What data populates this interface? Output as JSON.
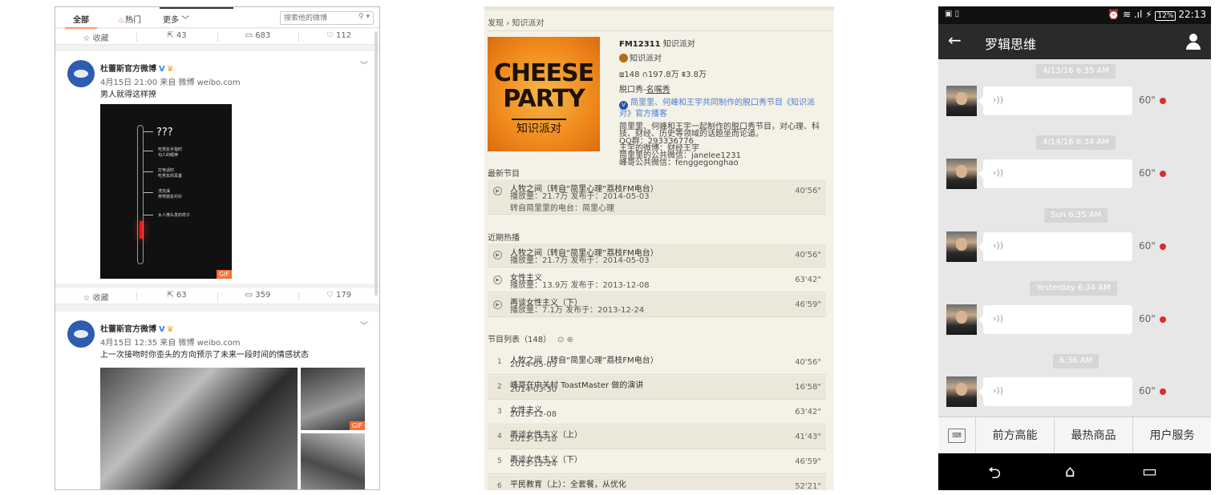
{
  "weibo": {
    "tabs": {
      "all": "全部",
      "hot_icon": "♨",
      "hot": "热门",
      "more": "更多 ﹀"
    },
    "search_placeholder": "搜索他的微博",
    "top_actions": {
      "favorite": "☆ 收藏",
      "repost": "⇱ 43",
      "comment": "▭ 683",
      "like": "♡ 112"
    },
    "posts": [
      {
        "author": "杜蕾斯官方微博",
        "time": "4月15日 21:00 来自 微博 weibo.com",
        "text": "男人就得这样撩",
        "gif_question": "???",
        "gif_labels": [
          "吃男友手指时\n勾人的眼神",
          "打电话时\n吃男友的耳垂",
          "洗完澡\n穿男朋友衬衫",
          "女人撩头发的样子"
        ],
        "gif_badge": "GIF",
        "actions": {
          "favorite": "☆ 收藏",
          "repost": "⇱ 63",
          "comment": "▭ 359",
          "like": "♡ 179"
        }
      },
      {
        "author": "杜蕾斯官方微博",
        "time": "4月15日 12:35 来自 微博 weibo.com",
        "text": "上一次接吻时你歪头的方向预示了未来一段时间的情感状态",
        "gif_badge": "GIF"
      }
    ]
  },
  "podcast": {
    "breadcrumb": "发现 › 知识派对",
    "cover": {
      "line1": "CHEESE",
      "line2": "PARTY",
      "line3": "知识派对"
    },
    "fm": "FM12311",
    "name": "知识派对",
    "host": "知识派对",
    "stats": "⧈148  ∩197.8万  ⩩3.8万",
    "category_prefix": "脱口秀-",
    "category": "名嘴秀",
    "verify": "简里里、何峰和王宇共同制作的脱口秀节目《知识派对》官方播客",
    "description": "简里里、何峰和王宇一起制作的脱口秀节目，对心理、科\n技、财经、历史等领域的话题坐而论道。\nQQ群：293336776\n王宇的微博：财经王宇\n简里里的公共微信：janelee1231\n峰哥公共微信：fenggegonghao",
    "latest_label": "最新节目",
    "latest": {
      "title": "人牧之间（转自“简里心理”荔枝FM电台）",
      "sub": "播放量：21.7万  发布于：2014-05-03",
      "sub2": "转自简里里的电台：简里心理",
      "duration": "40'56\""
    },
    "hot_label": "近期热播",
    "hot": [
      {
        "title": "人牧之间（转自“简里心理”荔枝FM电台）",
        "sub": "播放量：21.7万  发布于：2014-05-03",
        "duration": "40'56\""
      },
      {
        "title": "女性主义",
        "sub": "播放量：13.9万  发布于：2013-12-08",
        "duration": "63'42\""
      },
      {
        "title": "再谈女性主义（下）",
        "sub": "播放量：7.1万  发布于：2013-12-24",
        "duration": "46'59\""
      }
    ],
    "list_label": "节目列表（148）",
    "list_icons": "⊙ ⊕",
    "list": [
      {
        "num": "1",
        "title": "人牧之间（转自“简里心理”荔枝FM电台）",
        "date": "2014-05-03",
        "duration": "40'56\""
      },
      {
        "num": "2",
        "title": "峰哥在中关村 ToastMaster 做的演讲",
        "date": "2014-03-30",
        "duration": "16'58\""
      },
      {
        "num": "3",
        "title": "女性主义",
        "date": "2013-12-08",
        "duration": "63'42\""
      },
      {
        "num": "4",
        "title": "再谈女性主义（上）",
        "date": "2013-12-18",
        "duration": "41'43\""
      },
      {
        "num": "5",
        "title": "再谈女性主义（下）",
        "date": "2013-12-24",
        "duration": "46'59\""
      },
      {
        "num": "6",
        "title": "平民教育（上）：全套餐，从优化",
        "date": "",
        "duration": "52'21\""
      }
    ]
  },
  "android": {
    "status_left": "▣ ▯",
    "status_icons": "⏰ ≋ .ıl ⚡",
    "battery": "12%",
    "clock": "22:13",
    "back_icon": "←",
    "title": "罗辑思维",
    "messages": [
      {
        "stamp": "4/13/16 6:35 AM",
        "length": "60\""
      },
      {
        "stamp": "4/14/16 6:34 AM",
        "length": "60\""
      },
      {
        "stamp": "Sun 6:35 AM",
        "length": "60\""
      },
      {
        "stamp": "Yesterday 6:34 AM",
        "length": "60\""
      },
      {
        "stamp": "6:36 AM",
        "length": "60\""
      }
    ],
    "wave": "›))",
    "menu": [
      "前方高能",
      "最热商品",
      "用户服务"
    ],
    "keyboard_icon": "⌨",
    "nav": {
      "back": "⮌",
      "home": "⌂",
      "recent": "▭"
    },
    "colors": {
      "unread": "#e02a2a",
      "appbar": "#2a2a2a"
    }
  }
}
